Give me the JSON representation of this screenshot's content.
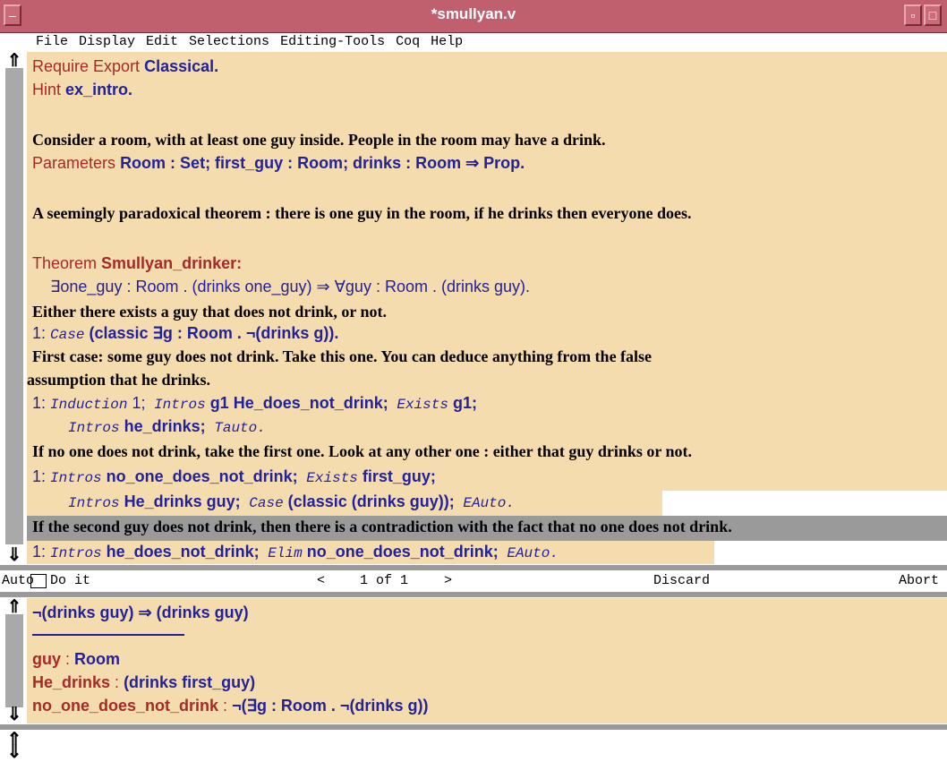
{
  "window": {
    "title": "*smullyan.v"
  },
  "menu": [
    "File",
    "Display",
    "Edit",
    "Selections",
    "Editing-Tools",
    "Coq",
    "Help"
  ],
  "editor": {
    "l1": {
      "a": "Require Export",
      "b": "Classical."
    },
    "l2": {
      "a": "Hint",
      "b": "ex_intro."
    },
    "l3": "Consider a room, with at least one guy inside.  People in the room may have a drink.",
    "l4": {
      "a": "Parameters",
      "b": "Room : Set;  first_guy : Room;  drinks : Room ⇒ Prop."
    },
    "l5": "A seemingly paradoxical theorem : there is one guy in the room, if he drinks then everyone does.",
    "l6": {
      "a": "Theorem",
      "b": "Smullyan_drinker:"
    },
    "l7": "∃one_guy : Room . (drinks  one_guy) ⇒ ∀guy : Room . (drinks  guy).",
    "l8": "Either there exists a guy that does not drink, or not.",
    "l9": {
      "n": "1:",
      "t": "Case",
      "r": "(classic ∃g : Room .  ¬(drinks  g))."
    },
    "l10": "First case: some guy does not drink. Take this one.  You can deduce anything from the false",
    "l11": "assumption that he drinks.",
    "l12": {
      "n": "1:",
      "t1": "Induction",
      "a1": " 1;",
      "t2": " Intros",
      "a2": " g1  He_does_not_drink;",
      "t3": " Exists",
      "a3": " g1;"
    },
    "l13": {
      "t1": "Intros",
      "a1": " he_drinks;",
      "t2": " Tauto."
    },
    "l14": "If no one does not drink,  take the first one.  Look at any other one : either that guy drinks or not.",
    "l15": {
      "n": "1:",
      "t1": "Intros",
      "a1": " no_one_does_not_drink;",
      "t2": " Exists",
      "a2": " first_guy;"
    },
    "l16": {
      "t1": "Intros",
      "a1": " He_drinks  guy;",
      "t2": " Case",
      "a2": " (classic  (drinks  guy));",
      "t3": " EAuto."
    },
    "l17": "If the second guy does not drink, then there is a contradiction with the fact that no  one  does  not  drink.",
    "l18": {
      "n": "1:",
      "t1": "Intros",
      "a1": " he_does_not_drink;",
      "t2": " Elim",
      "a2": " no_one_does_not_drink;",
      "t3": " EAuto."
    }
  },
  "status": {
    "auto": "Auto",
    "doit": "Do it",
    "prev": "<",
    "page": "1 of 1",
    "next": ">",
    "discard": "Discard",
    "abort": "Abort"
  },
  "goals": {
    "goal": "¬(drinks  guy) ⇒ (drinks  guy)",
    "h1": {
      "name": "guy",
      "colon": " : ",
      "type": "Room"
    },
    "h2": {
      "name": "He_drinks",
      "colon": " : ",
      "type": "(drinks  first_guy)"
    },
    "h3": {
      "name": "no_one_does_not_drink",
      "colon": " : ",
      "type": "¬(∃g : Room .  ¬(drinks  g))"
    }
  }
}
